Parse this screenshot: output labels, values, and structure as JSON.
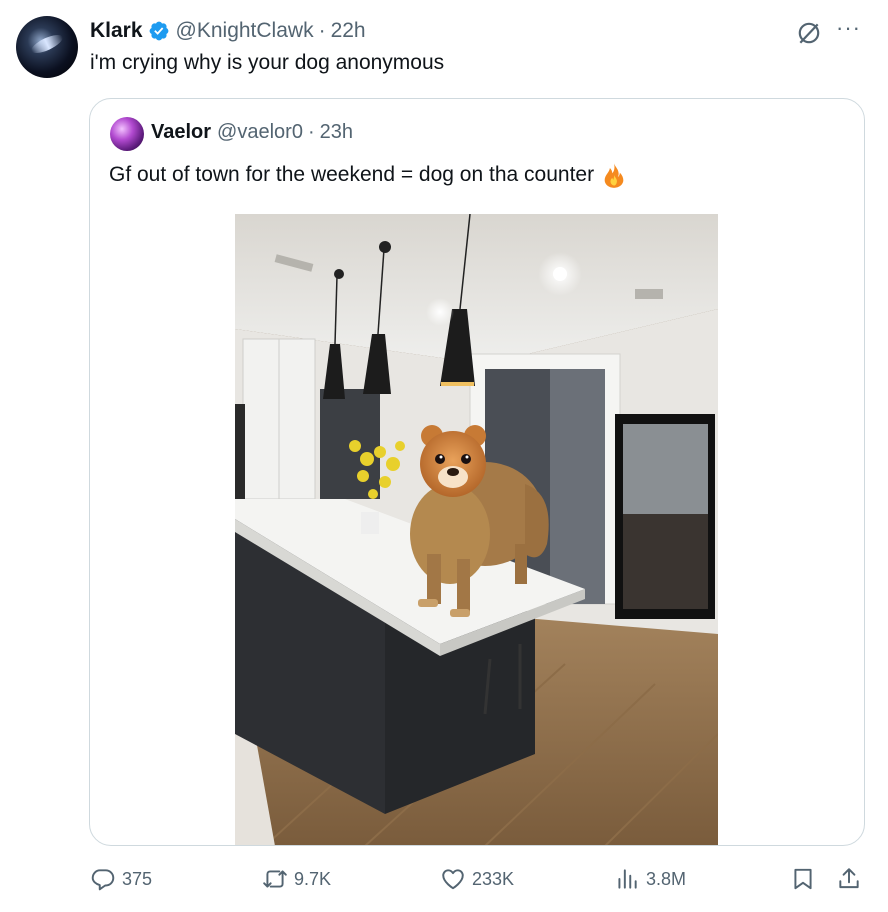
{
  "author": {
    "name": "Klark",
    "handle": "@KnightClawk",
    "separator": "·",
    "time": "22h",
    "verified": true,
    "avatar": "avatar-image"
  },
  "tweet": {
    "text": "i'm crying why is your dog anonymous"
  },
  "header_icons": {
    "grok": "grok-icon",
    "more": "···"
  },
  "quoted": {
    "name": "Vaelor",
    "handle": "@vaelor0",
    "separator": "·",
    "time": "23h",
    "text": "Gf out of town for the weekend = dog on tha counter",
    "emoji": "fire-icon",
    "media": "dog-on-kitchen-counter-photo"
  },
  "actions": {
    "replies": "375",
    "reposts": "9.7K",
    "likes": "233K",
    "views": "3.8M"
  },
  "colors": {
    "text": "#0f1419",
    "muted": "#536471",
    "verified": "#1d9bf0",
    "border": "#cfd9de"
  }
}
